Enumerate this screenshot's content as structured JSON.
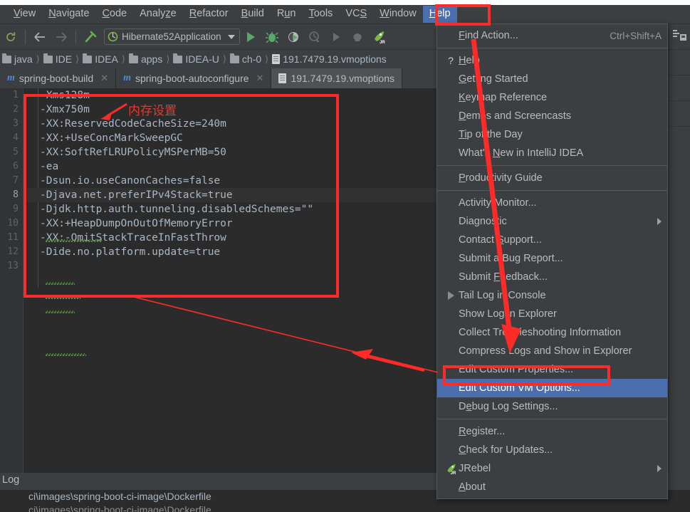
{
  "window": {
    "title": "IntelliJ IDEA"
  },
  "menubar": {
    "items": [
      {
        "label": "View",
        "mnemonic": "V"
      },
      {
        "label": "Navigate",
        "mnemonic": "N"
      },
      {
        "label": "Code",
        "mnemonic": "C"
      },
      {
        "label": "Analyze",
        "mnemonic": "z"
      },
      {
        "label": "Refactor",
        "mnemonic": "R"
      },
      {
        "label": "Build",
        "mnemonic": "B"
      },
      {
        "label": "Run",
        "mnemonic": "u"
      },
      {
        "label": "Tools",
        "mnemonic": "T"
      },
      {
        "label": "VCS",
        "mnemonic": "S"
      },
      {
        "label": "Window",
        "mnemonic": "W"
      },
      {
        "label": "Help",
        "mnemonic": "H",
        "active": true
      }
    ]
  },
  "toolbar": {
    "sync_icon": "sync-icon",
    "back_icon": "back-arrow-icon",
    "forward_icon": "forward-arrow-icon",
    "build_icon": "hammer-icon",
    "run_config": "Hibernate52Application",
    "run_icon": "run-icon",
    "debug_icon": "debug-icon",
    "run_coverage_icon": "run-with-coverage-icon",
    "profiler_icon": "profiler-icon",
    "rerun_icon": "rerun-icon",
    "stop_icon": "stop-icon",
    "jrebel_icon": "jrebel-run-icon"
  },
  "breadcrumbs": {
    "items": [
      {
        "label": "java",
        "icon": "folder-icon"
      },
      {
        "label": "IDE",
        "icon": "folder-icon"
      },
      {
        "label": "IDEA",
        "icon": "folder-icon"
      },
      {
        "label": "apps",
        "icon": "folder-icon"
      },
      {
        "label": "IDEA-U",
        "icon": "folder-icon"
      },
      {
        "label": "ch-0",
        "icon": "folder-icon"
      },
      {
        "label": "191.7479.19.vmoptions",
        "icon": "file-icon"
      }
    ]
  },
  "tabs": [
    {
      "label": "spring-boot-build",
      "icon": "maven-module-icon",
      "active": false,
      "closable": true
    },
    {
      "label": "spring-boot-autoconfigure",
      "icon": "maven-module-icon",
      "active": false,
      "closable": true
    },
    {
      "label": "191.7479.19.vmoptions",
      "icon": "file-icon",
      "active": true,
      "closable": false
    }
  ],
  "editor": {
    "file": "191.7479.19.vmoptions",
    "current_line": 8,
    "line_numbers": [
      "1",
      "2",
      "3",
      "4",
      "5",
      "6",
      "7",
      "8",
      "9",
      "10",
      "11",
      "12",
      "13"
    ],
    "lines": [
      "-Xms128m",
      "-Xmx750m",
      "-XX:ReservedCodeCacheSize=240m",
      "-XX:+UseConcMarkSweepGC",
      "-XX:SoftRefLRUPolicyMSPerMB=50",
      "-ea",
      "-Dsun.io.useCanonCaches=false",
      "-Djava.net.preferIPv4Stack=true",
      "-Djdk.http.auth.tunneling.disabledSchemes=\"\"",
      "-XX:+HeapDumpOnOutOfMemoryError",
      "-XX:-OmitStackTraceInFastThrow",
      "-Dide.no.platform.update=true",
      ""
    ]
  },
  "help_menu": {
    "items": [
      {
        "label": "Find Action...",
        "mnemonic": "F",
        "accel": "Ctrl+Shift+A",
        "glyph": "",
        "separator_after": true
      },
      {
        "label": "Help",
        "mnemonic": "H",
        "accel": "",
        "glyph": "?"
      },
      {
        "label": "Getting Started",
        "mnemonic": "G",
        "accel": "",
        "glyph": ""
      },
      {
        "label": "Keymap Reference",
        "mnemonic": "K",
        "accel": "",
        "glyph": ""
      },
      {
        "label": "Demos and Screencasts",
        "mnemonic": "D",
        "accel": "",
        "glyph": ""
      },
      {
        "label": "Tip of the Day",
        "mnemonic": "Ti",
        "accel": "",
        "glyph": ""
      },
      {
        "label": "What's New in IntelliJ IDEA",
        "mnemonic": "N",
        "accel": "",
        "glyph": "",
        "separator_after": true
      },
      {
        "label": "Productivity Guide",
        "mnemonic": "P",
        "accel": "",
        "glyph": "",
        "separator_after": true
      },
      {
        "label": "Activity Monitor...",
        "mnemonic": "",
        "accel": "",
        "glyph": ""
      },
      {
        "label": "Diagnostic",
        "mnemonic": "",
        "accel": "",
        "glyph": "",
        "submenu": true
      },
      {
        "label": "Contact Support...",
        "mnemonic": "S",
        "accel": "",
        "glyph": ""
      },
      {
        "label": "Submit a Bug Report...",
        "mnemonic": "",
        "accel": "",
        "glyph": ""
      },
      {
        "label": "Submit Feedback...",
        "mnemonic": "F",
        "accel": "",
        "glyph": ""
      },
      {
        "label": "Tail Log in Console",
        "mnemonic": "",
        "accel": "",
        "glyph": "tail-log-triangle-icon"
      },
      {
        "label": "Show Log in Explorer",
        "mnemonic": "",
        "accel": "",
        "glyph": ""
      },
      {
        "label": "Collect Troubleshooting Information",
        "mnemonic": "",
        "accel": "",
        "glyph": ""
      },
      {
        "label": "Compress Logs and Show in Explorer",
        "mnemonic": "",
        "accel": "",
        "glyph": ""
      },
      {
        "label": "Edit Custom Properties...",
        "mnemonic": "",
        "accel": "",
        "glyph": ""
      },
      {
        "label": "Edit Custom VM Options...",
        "mnemonic": "",
        "accel": "",
        "glyph": "",
        "selected": true
      },
      {
        "label": "Debug Log Settings...",
        "mnemonic": "e",
        "accel": "",
        "glyph": "",
        "separator_after": true
      },
      {
        "label": "Register...",
        "mnemonic": "R",
        "accel": "",
        "glyph": ""
      },
      {
        "label": "Check for Updates...",
        "mnemonic": "C",
        "accel": "",
        "glyph": ""
      },
      {
        "label": "JRebel",
        "mnemonic": "",
        "accel": "",
        "glyph": "jrebel-icon",
        "submenu": true
      },
      {
        "label": "About",
        "mnemonic": "A",
        "accel": "",
        "glyph": ""
      }
    ]
  },
  "log_panel": {
    "title": "Log",
    "lines": [
      "ci\\images\\spring-boot-ci-image\\Dockerfile",
      "     ci\\images\\spring-boot-ci-image\\Dockerfile"
    ]
  },
  "annotations": {
    "memory_note": "内存设置",
    "accent_color": "#ff2b28",
    "selection_color": "#4b6eaf"
  }
}
